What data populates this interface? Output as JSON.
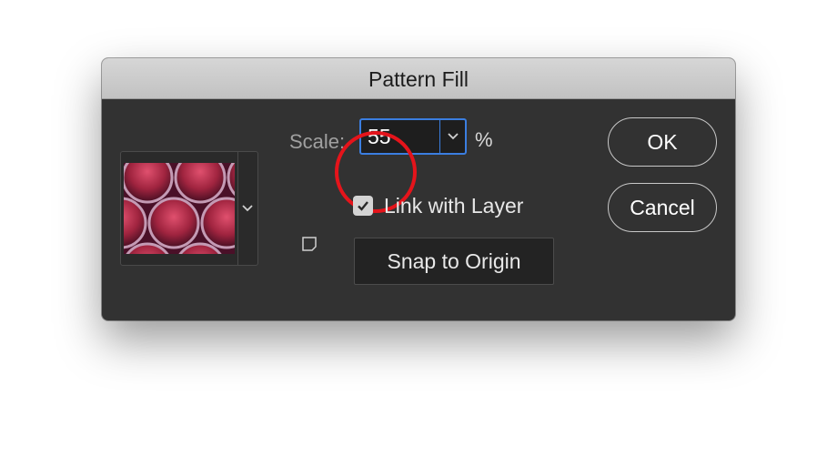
{
  "dialog": {
    "title": "Pattern Fill"
  },
  "scale": {
    "label": "Scale:",
    "value": "55",
    "unit": "%"
  },
  "link_with_layer": {
    "label": "Link with Layer",
    "checked": true
  },
  "snap_button": {
    "label": "Snap to Origin"
  },
  "buttons": {
    "ok_label": "OK",
    "cancel_label": "Cancel"
  },
  "icons": {
    "pattern_dropdown": "chevron-down-icon",
    "scale_dropdown": "chevron-down-icon",
    "new_preset": "new-preset-icon",
    "checkbox": "checkmark-icon"
  },
  "colors": {
    "dialog_bg": "#323232",
    "focus_ring": "#3b7ee0",
    "annotation": "#e5141b",
    "pattern_base": "#5a1530",
    "pattern_highlight": "#e0506e"
  }
}
